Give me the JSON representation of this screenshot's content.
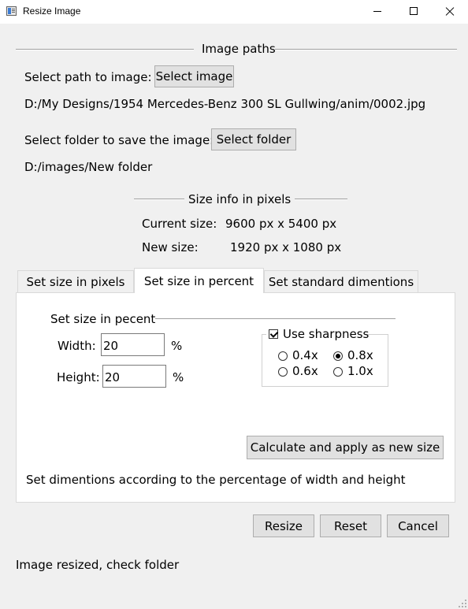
{
  "window": {
    "title": "Resize Image"
  },
  "image_paths": {
    "section_title": "Image paths",
    "select_image_label": "Select path to image:",
    "select_image_button": "Select image",
    "image_path": "D:/My Designs/1954 Mercedes-Benz 300 SL Gullwing/anim/0002.jpg",
    "select_folder_label": "Select folder to save the image:",
    "select_folder_button": "Select folder",
    "folder_path": "D:/images/New folder"
  },
  "size_info": {
    "section_title": "Size info in pixels",
    "current_label": "Current size:",
    "current_value": "9600 px x 5400 px",
    "new_label": "New size:",
    "new_value": "1920 px x 1080 px"
  },
  "tabs": [
    {
      "label": "Set size in pixels"
    },
    {
      "label": "Set size in percent"
    },
    {
      "label": "Set standard dimentions"
    }
  ],
  "active_tab": "Set size in percent",
  "percent_panel": {
    "group_title": "Set size in pecent",
    "width_label": "Width:",
    "width_value": "20",
    "width_unit": "%",
    "height_label": "Height:",
    "height_value": "20",
    "height_unit": "%",
    "sharpness": {
      "label": "Use sharpness",
      "checked": true,
      "options": [
        "0.4x",
        "0.8x",
        "0.6x",
        "1.0x"
      ],
      "selected": "0.8x"
    },
    "apply_button": "Calculate and apply as new size",
    "description": "Set dimentions according to the percentage of width and height"
  },
  "actions": {
    "resize": "Resize",
    "reset": "Reset",
    "cancel": "Cancel"
  },
  "status": "Image resized, check folder"
}
